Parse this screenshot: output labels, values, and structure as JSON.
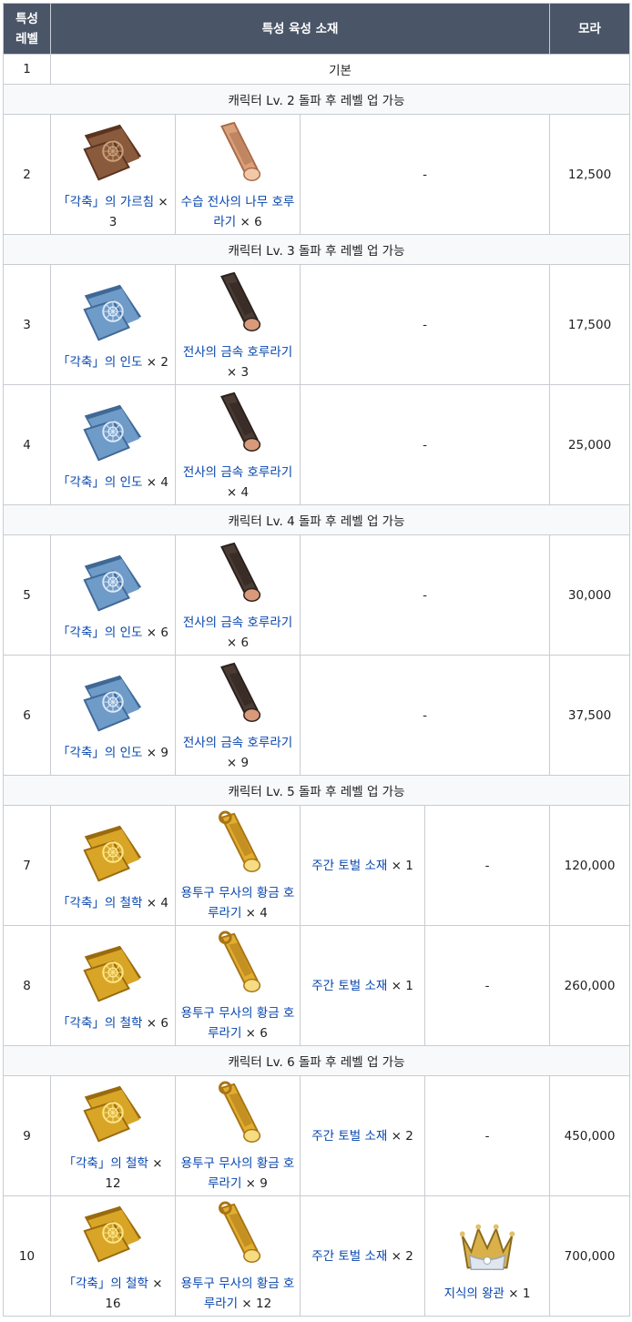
{
  "header": {
    "level": "특성\n레벨",
    "materials": "특성 육성 소재",
    "mora": "모라"
  },
  "rows": [
    {
      "type": "base",
      "level": "1",
      "text": "기본"
    },
    {
      "type": "note",
      "text": "캐릭터 Lv. 2 돌파 후 레벨 업 가능"
    },
    {
      "type": "item",
      "level": "2",
      "book": "「각축」의 가르침",
      "book_qty": "× 3",
      "book_tier": "bronze",
      "mat": "수습 전사의 나무 호루라기",
      "mat_qty": "× 6",
      "mat_tier": "wood",
      "weekly": "-",
      "crown": "",
      "mora": "12,500"
    },
    {
      "type": "note",
      "text": "캐릭터 Lv. 3 돌파 후 레벨 업 가능"
    },
    {
      "type": "item",
      "level": "3",
      "book": "「각축」의 인도",
      "book_qty": "× 2",
      "book_tier": "blue",
      "mat": "전사의 금속 호루라기",
      "mat_qty": "× 3",
      "mat_tier": "metal",
      "weekly": "-",
      "crown": "",
      "mora": "17,500"
    },
    {
      "type": "item",
      "level": "4",
      "book": "「각축」의 인도",
      "book_qty": "× 4",
      "book_tier": "blue",
      "mat": "전사의 금속 호루라기",
      "mat_qty": "× 4",
      "mat_tier": "metal",
      "weekly": "-",
      "crown": "",
      "mora": "25,000"
    },
    {
      "type": "note",
      "text": "캐릭터 Lv. 4 돌파 후 레벨 업 가능"
    },
    {
      "type": "item",
      "level": "5",
      "book": "「각축」의 인도",
      "book_qty": "× 6",
      "book_tier": "blue",
      "mat": "전사의 금속 호루라기",
      "mat_qty": "× 6",
      "mat_tier": "metal",
      "weekly": "-",
      "crown": "",
      "mora": "30,000"
    },
    {
      "type": "item",
      "level": "6",
      "book": "「각축」의 인도",
      "book_qty": "× 9",
      "book_tier": "blue",
      "mat": "전사의 금속 호루라기",
      "mat_qty": "× 9",
      "mat_tier": "metal",
      "weekly": "-",
      "crown": "",
      "mora": "37,500"
    },
    {
      "type": "note",
      "text": "캐릭터 Lv. 5 돌파 후 레벨 업 가능"
    },
    {
      "type": "item",
      "level": "7",
      "book": "「각축」의 철학",
      "book_qty": "× 4",
      "book_tier": "gold",
      "mat": "용투구 무사의 황금 호루라기",
      "mat_qty": "× 4",
      "mat_tier": "gold",
      "weekly": "주간 토벌 소재",
      "weekly_qty": "× 1",
      "crown": "-",
      "mora": "120,000"
    },
    {
      "type": "item",
      "level": "8",
      "book": "「각축」의 철학",
      "book_qty": "× 6",
      "book_tier": "gold",
      "mat": "용투구 무사의 황금 호루라기",
      "mat_qty": "× 6",
      "mat_tier": "gold",
      "weekly": "주간 토벌 소재",
      "weekly_qty": "× 1",
      "crown": "-",
      "mora": "260,000"
    },
    {
      "type": "note",
      "text": "캐릭터 Lv. 6 돌파 후 레벨 업 가능"
    },
    {
      "type": "item",
      "level": "9",
      "book": "「각축」의 철학",
      "book_qty": "× 12",
      "book_tier": "gold",
      "mat": "용투구 무사의 황금 호루라기",
      "mat_qty": "× 9",
      "mat_tier": "gold",
      "weekly": "주간 토벌 소재",
      "weekly_qty": "× 2",
      "crown": "-",
      "mora": "450,000"
    },
    {
      "type": "item",
      "level": "10",
      "book": "「각축」의 철학",
      "book_qty": "× 16",
      "book_tier": "gold",
      "mat": "용투구 무사의 황금 호루라기",
      "mat_qty": "× 12",
      "mat_tier": "gold",
      "weekly": "주간 토벌 소재",
      "weekly_qty": "× 2",
      "crown": "지식의 왕관",
      "crown_qty": "× 1",
      "mora": "700,000"
    }
  ],
  "colors": {
    "header_bg": "#4a5568",
    "link": "#0645ad",
    "border": "#c8ccd1",
    "note_bg": "#f8f9fa"
  }
}
